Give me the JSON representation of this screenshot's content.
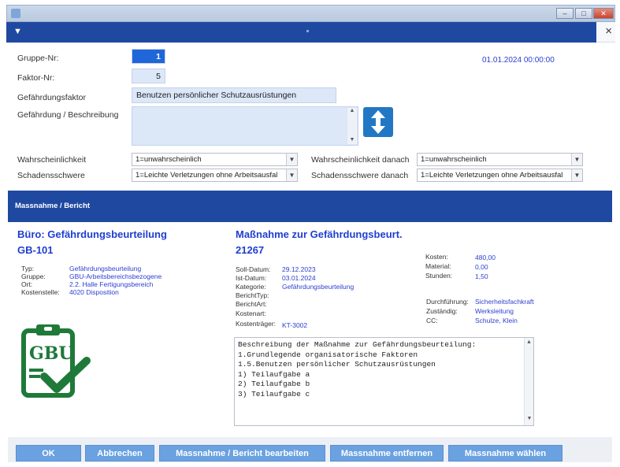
{
  "header": {
    "close_glyph": "×"
  },
  "form": {
    "gruppe_label": "Gruppe-Nr:",
    "gruppe_value": "1",
    "faktor_label": "Faktor-Nr:",
    "faktor_value": "5",
    "gefaehrdungsfaktor_label": "Gefährdungsfaktor",
    "gefaehrdungsfaktor_value": "Benutzen persönlicher Schutzausrüstungen",
    "beschreibung_label": "Gefährdung / Beschreibung",
    "date": "01.01.2024 00:00:00",
    "wahrscheinlichkeit_label": "Wahrscheinlichkeit",
    "wahrscheinlichkeit_value": "1=unwahrscheinlich",
    "wahrscheinlichkeit_danach_label": "Wahrscheinlichkeit danach",
    "wahrscheinlichkeit_danach_value": "1=unwahrscheinlich",
    "schadensschwere_label": "Schadensschwere",
    "schadensschwere_value": "1=Leichte Verletzungen ohne Arbeitsausfal",
    "schadensschwere_danach_label": "Schadensschwere danach",
    "schadensschwere_danach_value": "1=Leichte Verletzungen ohne Arbeitsausfal"
  },
  "section_bar": "Massnahme / Bericht",
  "left": {
    "title": "Büro: Gefährdungsbeurteilung",
    "id": "GB-101",
    "rows": [
      {
        "label": "Typ:",
        "value": "Gefährdungsbeurteilung"
      },
      {
        "label": "Gruppe:",
        "value": "GBU-Arbeitsbereichsbezogene"
      },
      {
        "label": "Ort:",
        "value": "2.2. Halle Fertigungsbereich"
      },
      {
        "label": "Kostenstelle:",
        "value": "4020 Disposition"
      }
    ],
    "logo_text": "GBU"
  },
  "middle": {
    "title": "Maßnahme zur Gefährdungsbeurt.",
    "id": "21267",
    "rows": [
      {
        "label": "Soll-Datum:",
        "value": "29.12.2023"
      },
      {
        "label": "Ist-Datum:",
        "value": "03.01.2024"
      },
      {
        "label": "Kategorie:",
        "value": "Gefährdungsbeurteilung"
      },
      {
        "label": "BerichtTyp:",
        "value": ""
      },
      {
        "label": "BerichtArt:",
        "value": ""
      },
      {
        "label": "Kostenart:",
        "value": ""
      },
      {
        "label": "Kostenträger:",
        "value": "KT-3002"
      }
    ]
  },
  "right": {
    "rows": [
      {
        "label": "Kosten:",
        "value": "480,00"
      },
      {
        "label": "Material:",
        "value": "0,00"
      },
      {
        "label": "Stunden:",
        "value": "1,50"
      }
    ],
    "rows2": [
      {
        "label": "Durchführung:",
        "value": "Sicherheitsfachkraft"
      },
      {
        "label": "Zuständig:",
        "value": "Werksleitung"
      },
      {
        "label": "CC:",
        "value": "Schulze, Klein"
      }
    ]
  },
  "description": [
    "Beschreibung der Maßnahme zur Gefährdungsbeurteilung:",
    "1.Grundlegende organisatorische Faktoren",
    "1.5.Benutzen persönlicher Schutzausrüstungen",
    "1) Teilaufgabe a",
    "2) Teilaufgabe b",
    "3) Teilaufgabe c"
  ],
  "buttons": {
    "ok": "OK",
    "abbrechen": "Abbrechen",
    "bearbeiten": "Massnahme / Bericht bearbeiten",
    "entfernen": "Massnahme entfernen",
    "waehlen": "Massnahme wählen"
  },
  "colors": {
    "accent": "#1f49a1",
    "link": "#2c3fd0",
    "button": "#6aa1e0",
    "logo": "#1f7a3a"
  },
  "icons": {
    "arrows": "up-down-arrow-icon",
    "menu": "hamburger-icon"
  }
}
